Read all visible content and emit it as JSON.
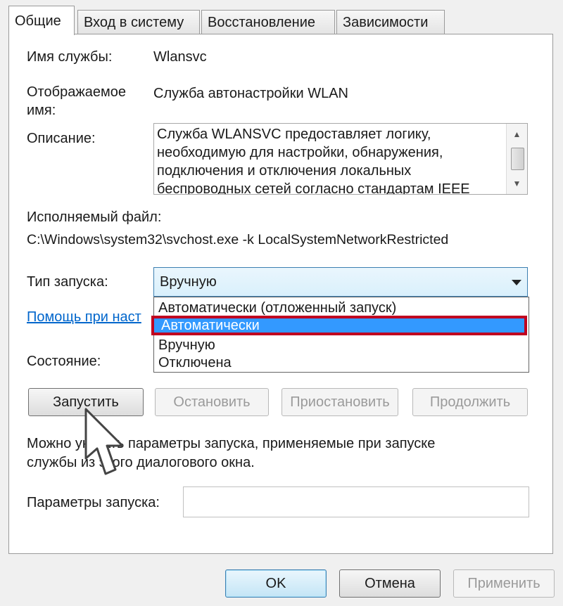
{
  "tabs": [
    {
      "label": "Общие",
      "active": true
    },
    {
      "label": "Вход в систему",
      "active": false
    },
    {
      "label": "Восстановление",
      "active": false
    },
    {
      "label": "Зависимости",
      "active": false
    }
  ],
  "service_name": {
    "label": "Имя службы:",
    "value": "Wlansvc"
  },
  "display_name": {
    "label_line1": "Отображаемое",
    "label_line2": "имя:",
    "value": "Служба автонастройки WLAN"
  },
  "description": {
    "label": "Описание:",
    "lines": [
      "Служба WLANSVC предоставляет логику,",
      "необходимую для настройки, обнаружения,",
      "подключения и отключения локальных",
      "беспроводных сетей согласно стандартам IEEE"
    ]
  },
  "executable": {
    "label": "Исполняемый файл:",
    "value": "C:\\Windows\\system32\\svchost.exe -k LocalSystemNetworkRestricted"
  },
  "startup_type": {
    "label": "Тип запуска:",
    "value": "Вручную",
    "options": [
      "Автоматически (отложенный запуск)",
      "Автоматически",
      "Вручную",
      "Отключена"
    ],
    "highlighted_option": "Автоматически"
  },
  "help_link": "Помощь при наст",
  "status": {
    "label": "Состояние:"
  },
  "service_buttons": {
    "start": "Запустить",
    "stop": "Остановить",
    "pause": "Приостановить",
    "resume": "Продолжить"
  },
  "hint_text": {
    "line1": "Можно указать параметры запуска, применяемые при запуске",
    "line2": "службы из этого диалогового окна."
  },
  "start_params": {
    "label": "Параметры запуска:",
    "value": ""
  },
  "dialog_buttons": {
    "ok": "OK",
    "cancel": "Отмена",
    "apply": "Применить"
  },
  "colors": {
    "selection": "#3399ff",
    "highlight_border": "#c00020",
    "link": "#0066cc"
  }
}
